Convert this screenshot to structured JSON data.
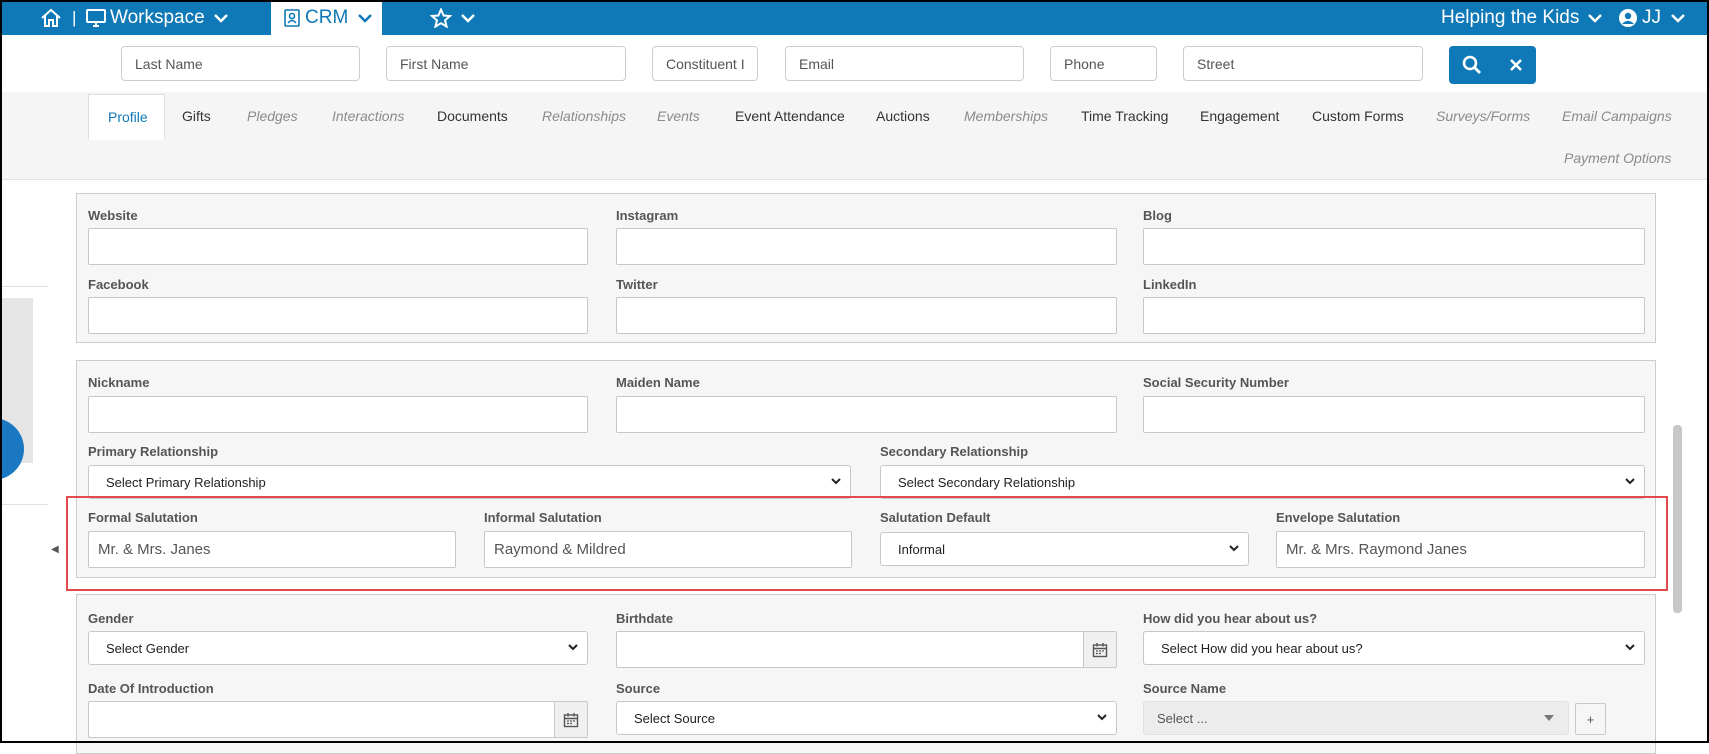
{
  "topbar": {
    "workspace_label": "Workspace",
    "crm_label": "CRM",
    "org_name": "Helping the Kids",
    "user_initials": "JJ",
    "separator": "|"
  },
  "search": {
    "last_name": "Last Name",
    "first_name": "First Name",
    "constituent_id": "Constituent ID",
    "email": "Email",
    "phone": "Phone",
    "street": "Street"
  },
  "tabs": {
    "profile": "Profile",
    "gifts": "Gifts",
    "pledges": "Pledges",
    "interactions": "Interactions",
    "documents": "Documents",
    "relationships": "Relationships",
    "events": "Events",
    "event_attendance": "Event Attendance",
    "auctions": "Auctions",
    "memberships": "Memberships",
    "time_tracking": "Time Tracking",
    "engagement": "Engagement",
    "custom_forms": "Custom Forms",
    "surveys_forms": "Surveys/Forms",
    "email_campaigns": "Email Campaigns",
    "payment_options": "Payment Options"
  },
  "social": {
    "website": "Website",
    "instagram": "Instagram",
    "blog": "Blog",
    "facebook": "Facebook",
    "twitter": "Twitter",
    "linkedin": "LinkedIn"
  },
  "personal": {
    "nickname": "Nickname",
    "maiden_name": "Maiden Name",
    "ssn": "Social Security Number",
    "primary_relationship": "Primary Relationship",
    "primary_relationship_value": "Select Primary Relationship",
    "secondary_relationship": "Secondary Relationship",
    "secondary_relationship_value": "Select Secondary Relationship",
    "formal_salutation": "Formal Salutation",
    "formal_salutation_value": "Mr. & Mrs. Janes",
    "informal_salutation": "Informal Salutation",
    "informal_salutation_value": "Raymond & Mildred",
    "salutation_default": "Salutation Default",
    "salutation_default_value": "Informal",
    "envelope_salutation": "Envelope Salutation",
    "envelope_salutation_value": "Mr. & Mrs. Raymond Janes"
  },
  "demographics": {
    "gender": "Gender",
    "gender_value": "Select Gender",
    "birthdate": "Birthdate",
    "how_heard": "How did you hear about us?",
    "how_heard_value": "Select How did you hear about us?",
    "date_of_introduction": "Date Of Introduction",
    "source": "Source",
    "source_value": "Select Source",
    "source_name": "Source Name",
    "source_name_value": "Select ...",
    "add_label": "+"
  },
  "colors": {
    "brand": "#0f78b6",
    "highlight": "#e34b4b"
  }
}
